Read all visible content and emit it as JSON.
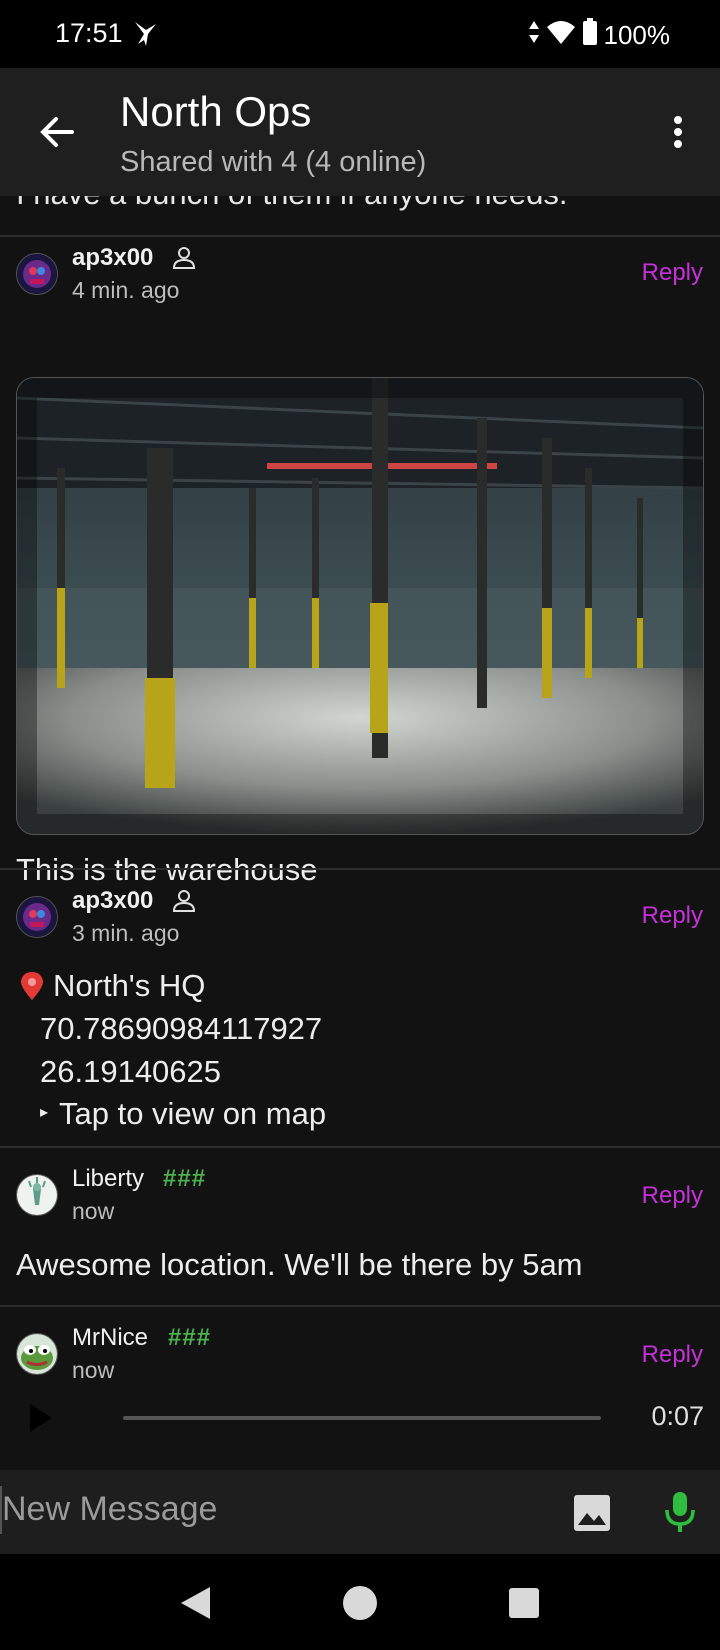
{
  "status": {
    "time": "17:51",
    "battery": "100%"
  },
  "header": {
    "title": "North Ops",
    "subtitle": "Shared with 4 (4 online)"
  },
  "partial_message": "I have a bunch of them if anyone needs.",
  "messages": [
    {
      "author": "ap3x00",
      "time": "4 min. ago",
      "reply": "Reply",
      "caption": "This is the warehouse"
    },
    {
      "author": "ap3x00",
      "time": "3 min. ago",
      "reply": "Reply",
      "location": {
        "name": "North's HQ",
        "lat": "70.78690984117927",
        "lon": "26.19140625",
        "action": "Tap to view on map"
      }
    },
    {
      "author": "Liberty",
      "badge": "###",
      "time": "now",
      "reply": "Reply",
      "text": "Awesome location. We'll be there by 5am"
    },
    {
      "author": "MrNice",
      "badge": "###",
      "time": "now",
      "reply": "Reply",
      "audio": {
        "duration": "0:07",
        "progress": 0
      }
    }
  ],
  "composer": {
    "placeholder": "New Message"
  },
  "colors": {
    "reply": "#c531d9",
    "badge": "#4caf50",
    "mic": "#2fbd3f"
  }
}
